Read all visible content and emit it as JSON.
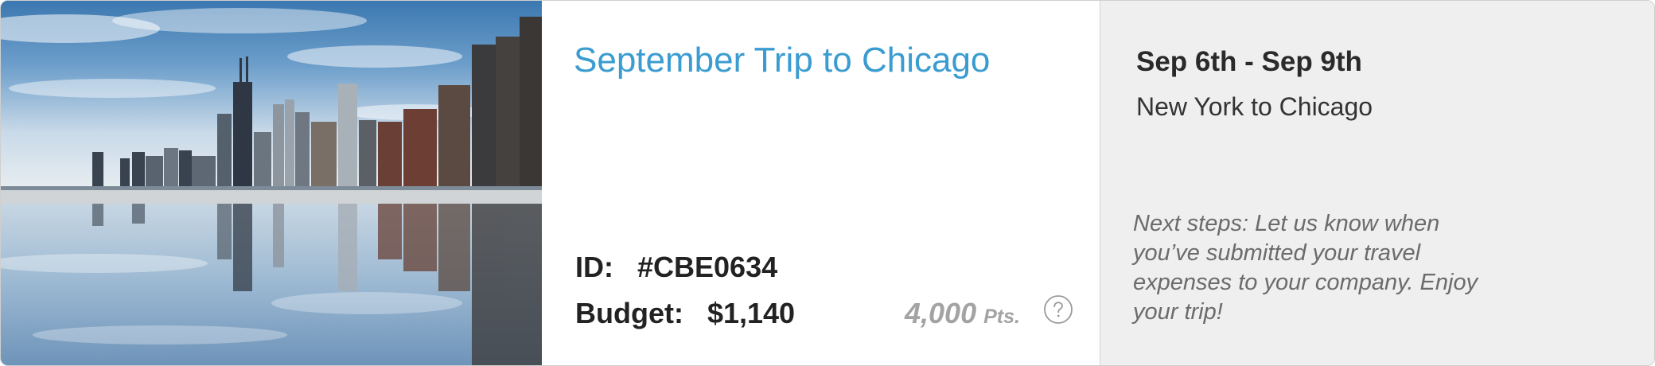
{
  "trip": {
    "title": "September Trip to Chicago",
    "id_label": "ID:",
    "id_value": "#CBE0634",
    "budget_label": "Budget:",
    "budget_value": "$1,140",
    "points_value": "4,000",
    "points_unit": "Pts.",
    "photo_subject": "chicago-skyline-reflection"
  },
  "summary": {
    "dates": "Sep 6th - Sep 9th",
    "route": "New York to Chicago",
    "next_steps": "Next steps: Let us know when you’ve submitted your travel expenses to your company. Enjoy your trip!"
  },
  "icons": {
    "help": "question-circle-icon"
  },
  "colors": {
    "title_blue": "#3a9cd0",
    "points_gray": "#a3a3a3",
    "summary_bg": "#efefef"
  }
}
